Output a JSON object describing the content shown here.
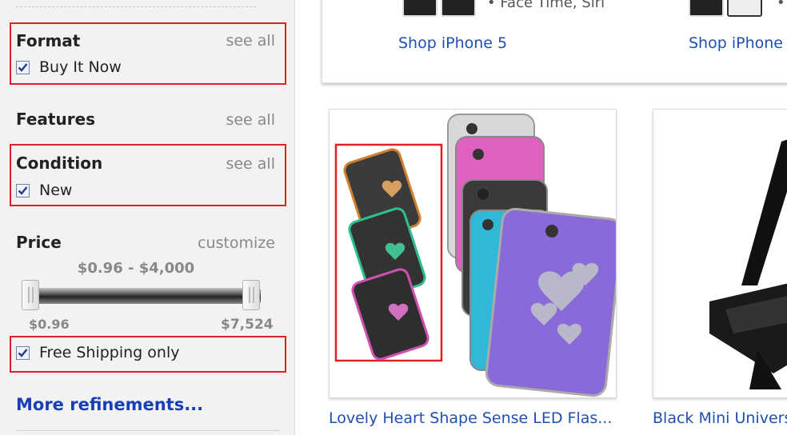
{
  "sidebar": {
    "format": {
      "title": "Format",
      "see_all": "see all",
      "option": "Buy It Now",
      "checked": true
    },
    "features": {
      "title": "Features",
      "see_all": "see all"
    },
    "condition": {
      "title": "Condition",
      "see_all": "see all",
      "option": "New",
      "checked": true
    },
    "price": {
      "title": "Price",
      "customize": "customize",
      "range": "$0.96 - $4,000",
      "min_label": "$0.96",
      "max_label": "$7,524"
    },
    "free_shipping": {
      "label": "Free Shipping only",
      "checked": true
    },
    "more_link": "More refinements..."
  },
  "promo": {
    "bullet_text": "Face Time, Siri",
    "shop_iphone5": "Shop iPhone 5",
    "shop_iphone": "Shop iPhone"
  },
  "products": [
    {
      "title": "Lovely Heart Shape Sense LED Flas..."
    },
    {
      "title": "Black Mini Univers"
    }
  ],
  "colors": {
    "highlight": "#e02020",
    "link": "#1f4fb4",
    "more_link": "#1a3fb5"
  }
}
